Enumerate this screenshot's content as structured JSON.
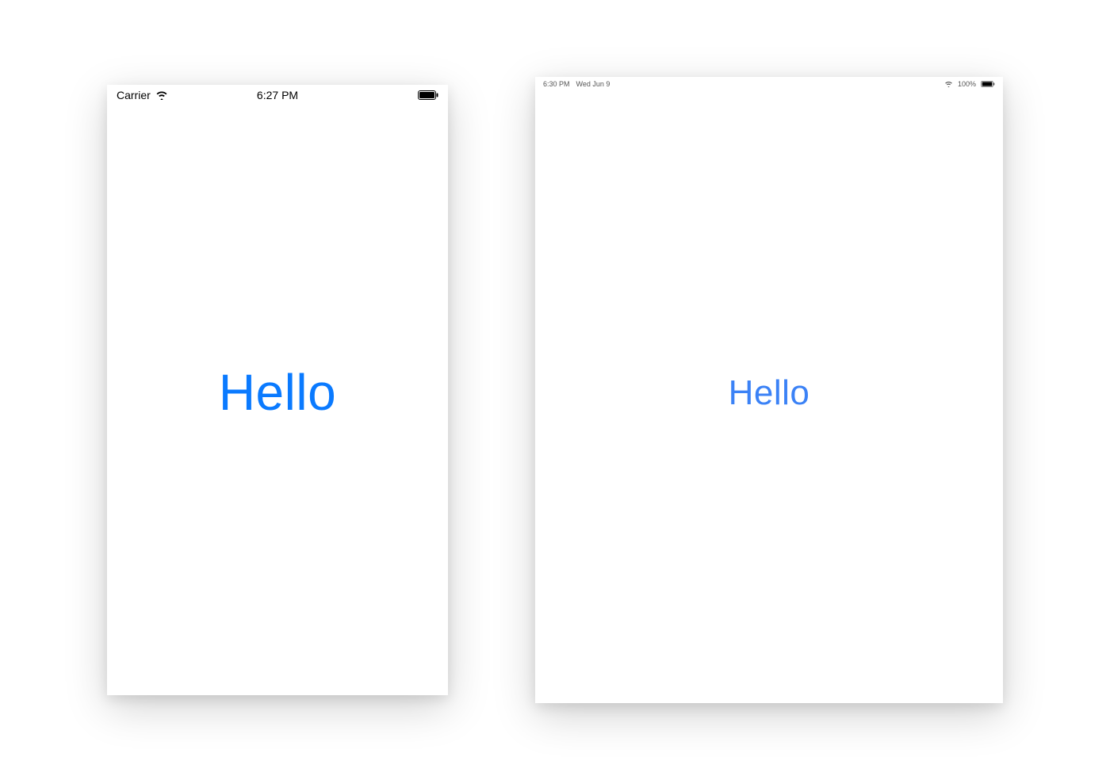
{
  "phone": {
    "status": {
      "carrier": "Carrier",
      "time": "6:27 PM"
    },
    "content": {
      "label": "Hello"
    }
  },
  "tablet": {
    "status": {
      "time": "6:30 PM",
      "date": "Wed Jun 9",
      "battery": "100%"
    },
    "content": {
      "label": "Hello"
    }
  },
  "colors": {
    "accent": "#0a7aff"
  }
}
